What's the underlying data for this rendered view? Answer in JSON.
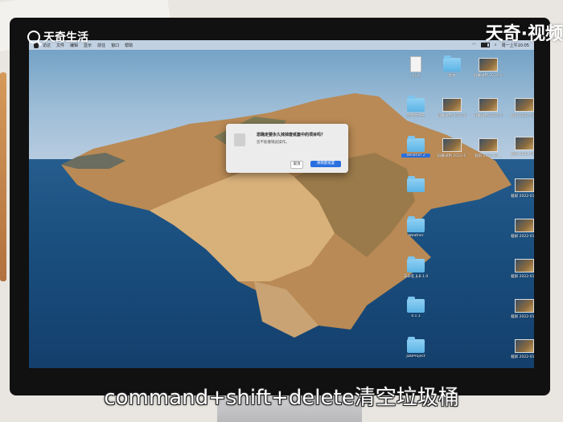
{
  "watermark": {
    "top_left": "天奇生活",
    "top_right": "天奇·视频"
  },
  "menubar": {
    "items": [
      "访达",
      "文件",
      "编辑",
      "显示",
      "前往",
      "窗口",
      "帮助"
    ],
    "battery": "",
    "clock": "周一上午10:05"
  },
  "dialog": {
    "title": "您确定要永久抹掉废纸篓中的项目吗？",
    "message": "您不能撤销此操作。",
    "cancel_label": "取消",
    "confirm_label": "清倒废纸篓"
  },
  "desktop_icons": [
    {
      "label": "2026",
      "kind": "doc"
    },
    {
      "label": "新建文件夹",
      "kind": "folder"
    },
    {
      "label": "Weather 2",
      "kind": "folder",
      "selected": true
    },
    {
      "label": "",
      "kind": "folder"
    },
    {
      "label": "Weather",
      "kind": "folder"
    },
    {
      "label": "未命名 JLB.1.0",
      "kind": "folder"
    },
    {
      "label": "4.1.1",
      "kind": "folder"
    },
    {
      "label": "JDBProject",
      "kind": "folder"
    },
    {
      "label": "副本",
      "kind": "folder"
    },
    {
      "label": "屏幕录制 2022-01...",
      "kind": "shot"
    },
    {
      "label": "屏幕录制 2022-01...",
      "kind": "shot"
    },
    {
      "label": "屏幕录制 2022-01...",
      "kind": "shot"
    },
    {
      "label": "屏幕录制 2022-01...",
      "kind": "shot"
    },
    {
      "label": "截屏 2022-01...",
      "kind": "shot"
    },
    {
      "label": "截屏 2022-01...",
      "kind": "shot"
    },
    {
      "label": "截屏 2022-01...",
      "kind": "shot"
    },
    {
      "label": "截屏 2022-01...",
      "kind": "shot"
    },
    {
      "label": "截屏 2022-01...",
      "kind": "shot"
    },
    {
      "label": "截屏 2022-01...",
      "kind": "shot"
    },
    {
      "label": "截屏 2022-01...",
      "kind": "shot"
    },
    {
      "label": "截屏 2022-01...",
      "kind": "shot"
    }
  ],
  "subtitle": "command+shift+delete清空垃圾桶"
}
